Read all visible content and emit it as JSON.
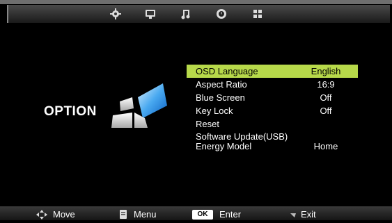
{
  "tabs": [
    {
      "icon": "gear-icon"
    },
    {
      "icon": "monitor-icon"
    },
    {
      "icon": "music-note-icon"
    },
    {
      "icon": "clock-icon"
    },
    {
      "icon": "grid-option-icon"
    }
  ],
  "page": {
    "title": "OPTION"
  },
  "menu": {
    "items": [
      {
        "label": "OSD Language",
        "value": "English"
      },
      {
        "label": "Aspect Ratio",
        "value": "16:9"
      },
      {
        "label": "Blue Screen",
        "value": "Off"
      },
      {
        "label": "Key Lock",
        "value": "Off"
      },
      {
        "label": "Reset",
        "value": ""
      },
      {
        "label": "Software Update(USB)",
        "value": ""
      },
      {
        "label": "Energy Model",
        "value": "Home"
      }
    ],
    "selected_index": 0
  },
  "footer": {
    "move": "Move",
    "menu": "Menu",
    "ok_badge": "OK",
    "enter": "Enter",
    "exit": "Exit"
  },
  "colors": {
    "highlight": "#b7d94a",
    "background": "#000000"
  }
}
